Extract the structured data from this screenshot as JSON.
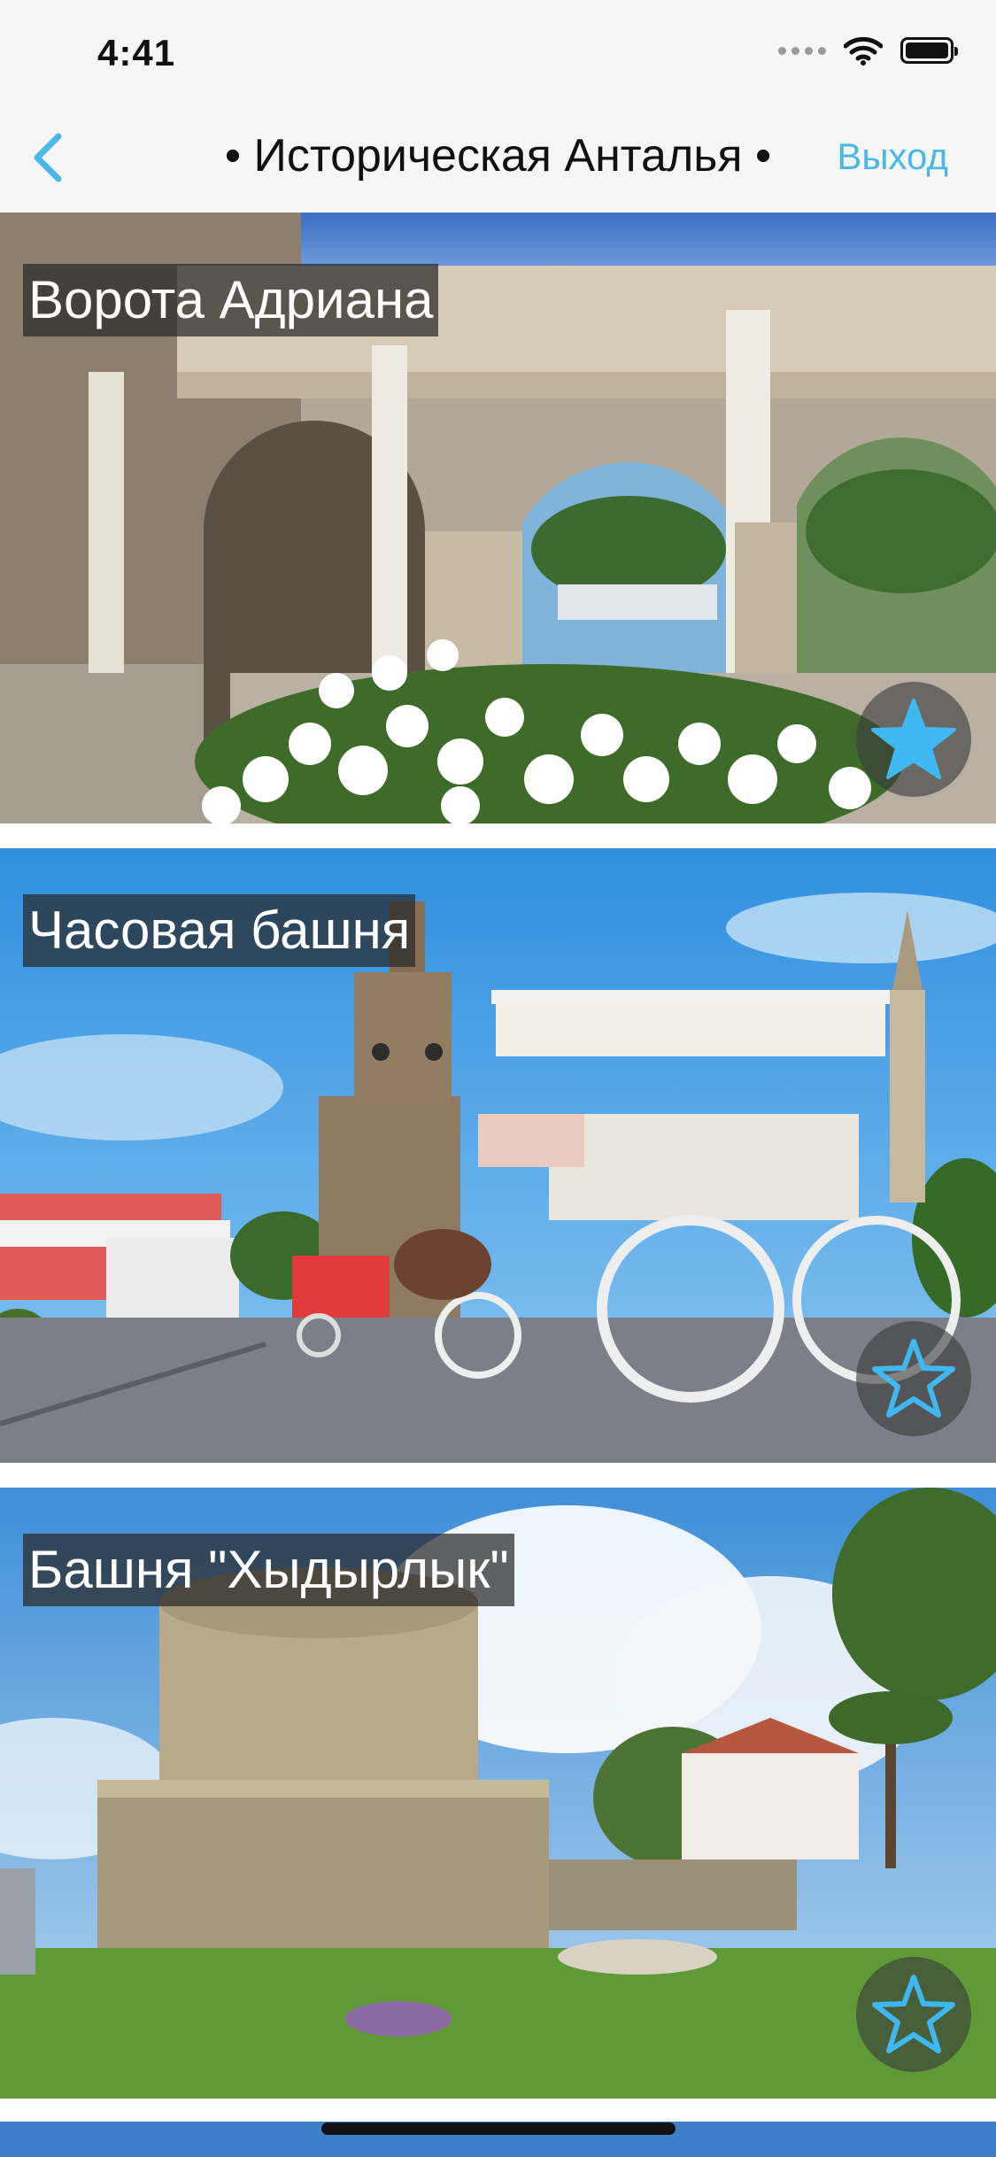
{
  "status": {
    "time": "4:41"
  },
  "nav": {
    "title": "• Историческая Анталья •",
    "exit_label": "Выход"
  },
  "places": [
    {
      "title": "Ворота Адриана",
      "favorite": true
    },
    {
      "title": "Часовая башня",
      "favorite": false
    },
    {
      "title": "Башня \"Хыдырлык\"",
      "favorite": false
    }
  ],
  "colors": {
    "accent": "#49b8e8",
    "star_filled": "#3fb8f0",
    "tag_bg": "#282828"
  }
}
